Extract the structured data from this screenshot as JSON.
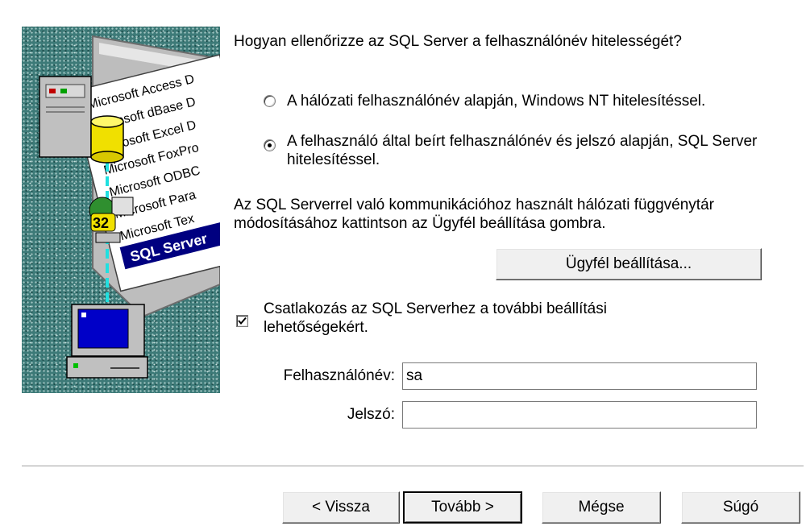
{
  "question": "Hogyan ellenőrizze az SQL Server a felhasználónév hitelességét?",
  "auth_options": [
    {
      "label": "A hálózati felhasználónév alapján, Windows NT hitelesítéssel.",
      "selected": false
    },
    {
      "label": "A felhasználó által beírt felhasználónév és jelszó alapján, SQL Server hitelesítéssel.",
      "selected": true
    }
  ],
  "network_info": "Az SQL Serverrel való kommunikációhoz használt hálózati függvénytár módosításához kattintson az Ügyfél beállítása gombra.",
  "client_config_button": "Ügyfél beállítása...",
  "connect_checkbox": {
    "label": "Csatlakozás az SQL Serverhez a további beállítási lehetőségekért.",
    "checked": true
  },
  "login": {
    "label": "Felhasználónév:",
    "value": "sa"
  },
  "password": {
    "label": "Jelszó:",
    "value": ""
  },
  "illustration": {
    "drivers": [
      "Microsoft Access D",
      "Microsoft dBase D",
      "Microsoft Excel D",
      "Microsoft FoxPro",
      "Microsoft ODBC",
      "Microsoft Para",
      "Microsoft Tex"
    ],
    "selected_driver": "SQL Server",
    "badge": "32"
  },
  "buttons": {
    "back": "< Vissza",
    "next": "Tovább >",
    "cancel": "Mégse",
    "help": "Súgó"
  }
}
